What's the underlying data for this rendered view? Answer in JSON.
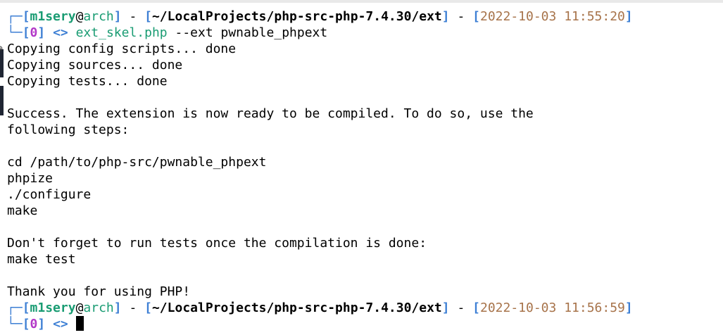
{
  "terminal": {
    "prompt1": {
      "user": "m1sery",
      "at": "@",
      "host": "arch",
      "sep": " - ",
      "cwd": "~/LocalProjects/php-src-php-7.4.30/ext",
      "timestamp": "2022-10-03 11:55:20",
      "exit_code": "0",
      "prompt_symbol": "<>",
      "command": "ext_skel.php",
      "args": " --ext pwnable_phpext"
    },
    "output": [
      "Copying config scripts... done",
      "Copying sources... done",
      "Copying tests... done",
      "",
      "Success. The extension is now ready to be compiled. To do so, use the",
      "following steps:",
      "",
      "cd /path/to/php-src/pwnable_phpext",
      "phpize",
      "./configure",
      "make",
      "",
      "Don't forget to run tests once the compilation is done:",
      "make test",
      "",
      "Thank you for using PHP!"
    ],
    "prompt2": {
      "user": "m1sery",
      "at": "@",
      "host": "arch",
      "sep": " - ",
      "cwd": "~/LocalProjects/php-src-php-7.4.30/ext",
      "timestamp": "2022-10-03 11:56:59",
      "exit_code": "0",
      "prompt_symbol": "<>"
    }
  },
  "icons": {
    "gutter": "scroll-anchor-icon"
  }
}
